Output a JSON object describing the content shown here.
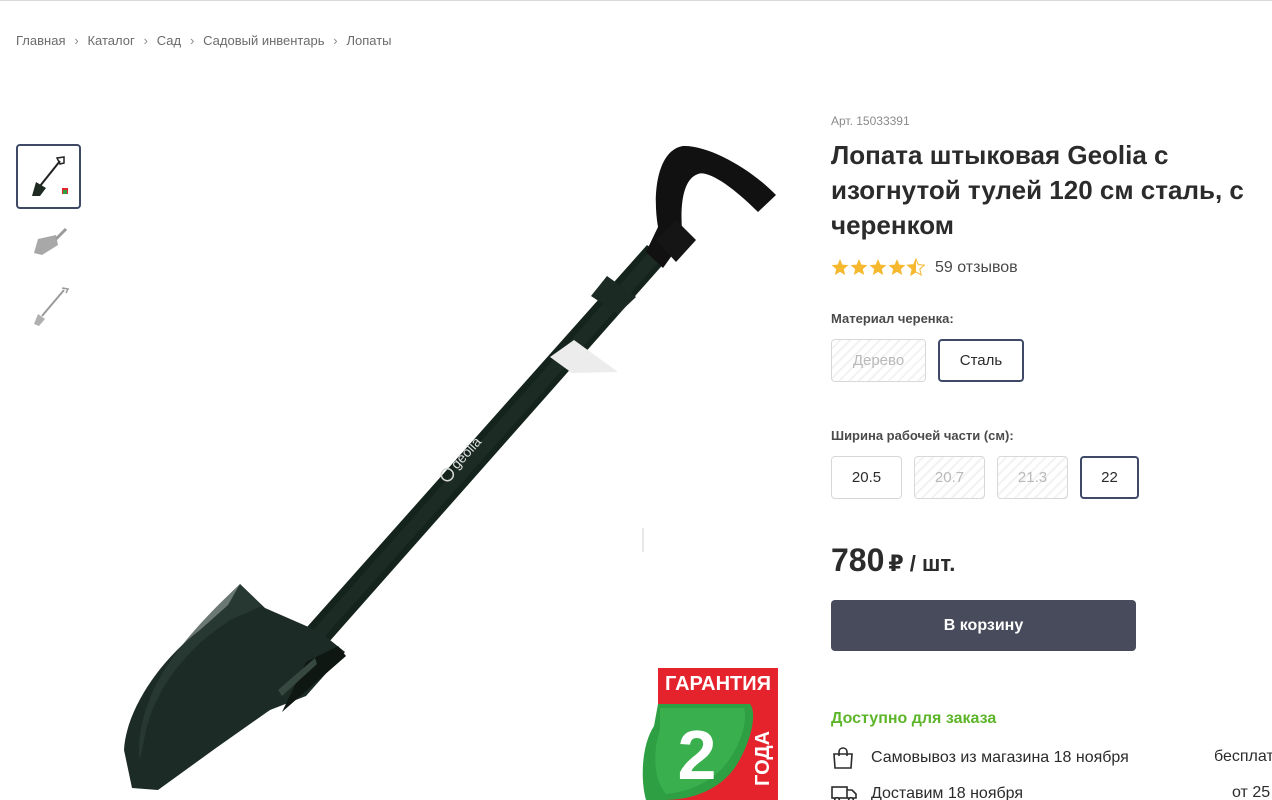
{
  "breadcrumb": [
    "Главная",
    "Каталог",
    "Сад",
    "Садовый инвентарь",
    "Лопаты"
  ],
  "breadcrumb_separator_icon": "chevron-right-icon",
  "gallery": {
    "thumbnails": [
      "shovel-photo-front",
      "shovel-blade-photo",
      "shovel-side-photo"
    ],
    "active_index": 0,
    "main_image": "shovel-main-photo",
    "warranty_badge": {
      "top": "ГАРАНТИЯ",
      "number": "2",
      "side": "ГОДА"
    },
    "handle_brand": "geolia"
  },
  "product": {
    "sku": "Арт. 15033391",
    "title": "Лопата штыковая Geolia с изогнутой тулей 120 см сталь, с черенком",
    "rating": 4.5,
    "reviews": "59 отзывов"
  },
  "options": {
    "material": {
      "label": "Материал черенка:",
      "items": [
        {
          "label": "Дерево",
          "state": "unavailable"
        },
        {
          "label": "Сталь",
          "state": "selected"
        }
      ]
    },
    "width": {
      "label": "Ширина рабочей части (см):",
      "items": [
        {
          "label": "20.5",
          "state": "available"
        },
        {
          "label": "20.7",
          "state": "unavailable"
        },
        {
          "label": "21.3",
          "state": "unavailable"
        },
        {
          "label": "22",
          "state": "selected"
        }
      ]
    }
  },
  "price": {
    "value": "780",
    "unit": "₽ / шт."
  },
  "cart_button": "В корзину",
  "availability": "Доступно для заказа",
  "delivery": [
    {
      "icon": "shopping-bag-icon",
      "text": "Самовывоз из магазина 18 ноября",
      "price": "бесплатно"
    },
    {
      "icon": "truck-icon",
      "text": "Доставим 18 ноября",
      "price": "от 25"
    }
  ],
  "colors": {
    "accent": "#474b5b",
    "selected_border": "#3d4966",
    "available_green": "#5db52a",
    "star": "#f5b82e",
    "warranty_red": "#e4232c",
    "warranty_green": "#2ea043"
  }
}
